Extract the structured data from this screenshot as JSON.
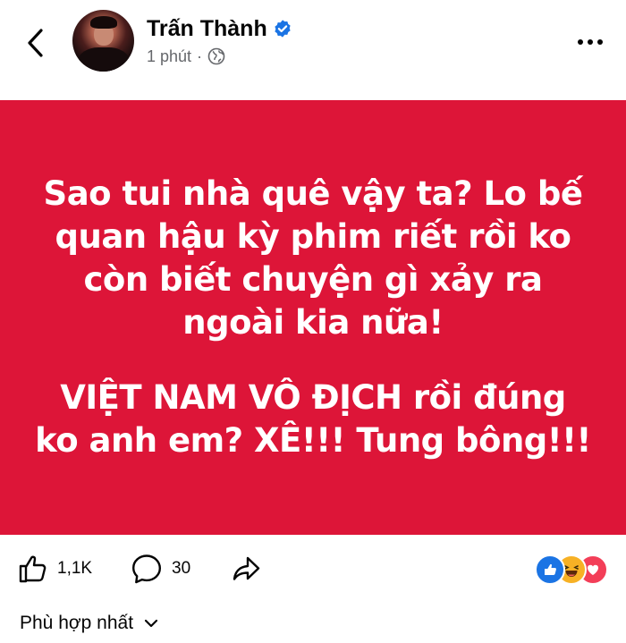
{
  "header": {
    "author_name": "Trấn Thành",
    "timestamp": "1 phút",
    "separator": "·",
    "icons": {
      "back": "chevron-left-icon",
      "verified": "verified-badge-icon",
      "audience": "globe-icon",
      "more": "more-horizontal-icon"
    }
  },
  "post": {
    "background_color": "#dd1538",
    "text_color": "#ffffff",
    "paragraph1": [
      "Sao tui nhà quê vậy ta? Lo bế",
      "quan hậu kỳ phim riết rồi ko",
      "còn biết chuyện gì xảy ra",
      "ngoài kia nữa!"
    ],
    "paragraph2": [
      "VIỆT NAM VÔ ĐỊCH rồi đúng",
      "ko anh em? XÊ!!! Tung bông!!!"
    ]
  },
  "actions": {
    "like_count": "1,1K",
    "comment_count": "30",
    "icons": {
      "like": "thumbs-up-icon",
      "comment": "comment-bubble-icon",
      "share": "share-arrow-icon"
    },
    "reactions": [
      "like-reaction-icon",
      "haha-reaction-icon",
      "love-reaction-icon"
    ],
    "colors": {
      "like": "#1b74e4",
      "haha": "#f7b125",
      "love": "#f33e58"
    }
  },
  "comments": {
    "sort_label": "Phù hợp nhất"
  }
}
